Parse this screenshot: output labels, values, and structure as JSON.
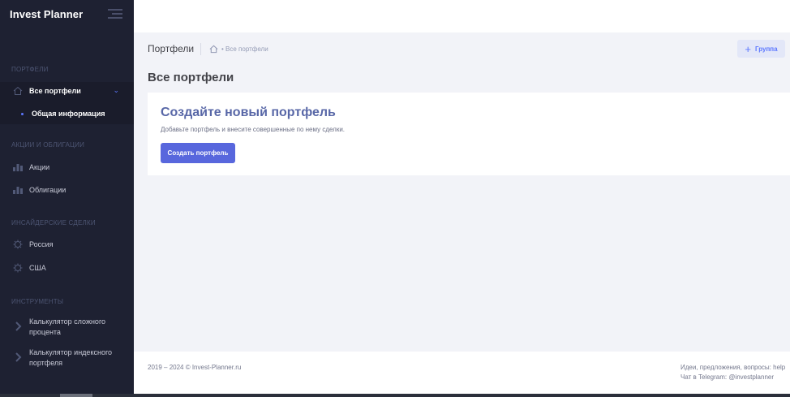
{
  "sidebar": {
    "brand": "Invest Planner",
    "sections": [
      {
        "title": "ПОРТФЕЛИ"
      },
      {
        "title": "АКЦИИ И ОБЛИГАЦИИ"
      },
      {
        "title": "ИНСАЙДЕРСКИЕ СДЕЛКИ"
      },
      {
        "title": "ИНСТРУМЕНТЫ"
      }
    ],
    "portfolios": {
      "label": "Все портфели",
      "icon": "home-icon",
      "sub_label": "Общая информация"
    },
    "stocks": {
      "label": "Акции",
      "icon": "bar-chart-icon"
    },
    "bonds": {
      "label": "Облигации",
      "icon": "bar-chart-icon"
    },
    "russia": {
      "label": "Россия",
      "icon": "gear-icon"
    },
    "usa": {
      "label": "США",
      "icon": "gear-icon"
    },
    "calc_compound": {
      "line1": "Калькулятор сложного",
      "line2": "процента",
      "icon": "chevron-right-icon"
    },
    "calc_index": {
      "line1": "Калькулятор индексного",
      "line2": "портфеля",
      "icon": "chevron-right-icon"
    }
  },
  "subheader": {
    "title": "Портфели",
    "breadcrumb": "Все портфели",
    "group_button": "Группа"
  },
  "page_title": "Все портфели",
  "card": {
    "title": "Создайте новый портфель",
    "description": "Добавьте портфель и внесите совершенные по нему сделки.",
    "button": "Создать портфель"
  },
  "footer": {
    "copyright": "2019 – 2024 © Invest-Planner.ru",
    "contact_line1": "Идеи, предложения, вопросы: help",
    "contact_line2": "Чат в Telegram: @investplanner"
  },
  "colors": {
    "sidebar_bg": "#1e2132",
    "accent": "#5867dd",
    "page_bg": "#f2f3f8"
  }
}
